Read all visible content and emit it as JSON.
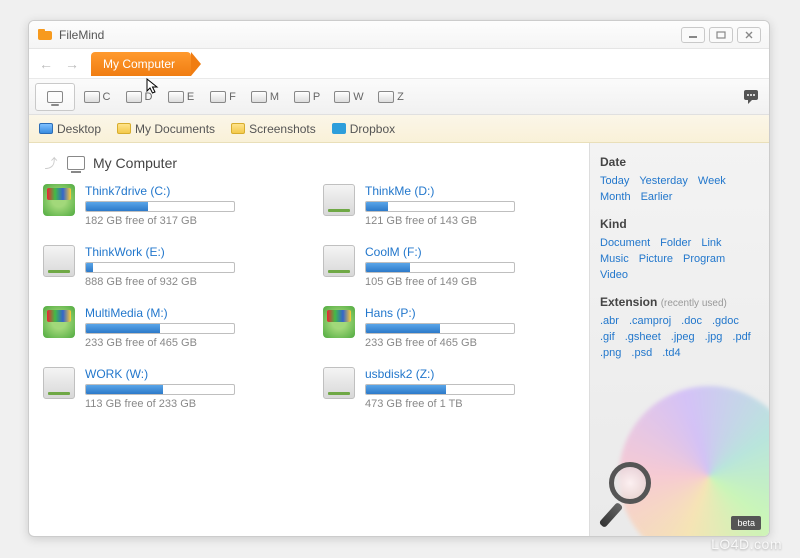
{
  "app": {
    "title": "FileMind",
    "beta": "beta"
  },
  "tab": {
    "label": "My Computer"
  },
  "drive_tabs": [
    "C",
    "D",
    "E",
    "F",
    "M",
    "P",
    "W",
    "Z"
  ],
  "quickbar": [
    {
      "label": "Desktop",
      "icon": "desktop"
    },
    {
      "label": "My Documents",
      "icon": "folder"
    },
    {
      "label": "Screenshots",
      "icon": "folder"
    },
    {
      "label": "Dropbox",
      "icon": "dropbox"
    }
  ],
  "location": {
    "title": "My Computer"
  },
  "drives": [
    {
      "name": "Think7drive (C:)",
      "free": "182 GB free of 317 GB",
      "pct": 42,
      "icon": "win"
    },
    {
      "name": "ThinkMe (D:)",
      "free": "121 GB free of 143 GB",
      "pct": 15,
      "icon": "plain"
    },
    {
      "name": "ThinkWork (E:)",
      "free": "888 GB free of 932 GB",
      "pct": 5,
      "icon": "plain"
    },
    {
      "name": "CoolM (F:)",
      "free": "105 GB free of 149 GB",
      "pct": 30,
      "icon": "plain"
    },
    {
      "name": "MultiMedia (M:)",
      "free": "233 GB free of 465 GB",
      "pct": 50,
      "icon": "win"
    },
    {
      "name": "Hans (P:)",
      "free": "233 GB free of 465 GB",
      "pct": 50,
      "icon": "win"
    },
    {
      "name": "WORK (W:)",
      "free": "113 GB free of 233 GB",
      "pct": 52,
      "icon": "plain"
    },
    {
      "name": "usbdisk2 (Z:)",
      "free": "473 GB free of 1 TB",
      "pct": 54,
      "icon": "plain"
    }
  ],
  "sidebar": {
    "date_h": "Date",
    "dates": [
      "Today",
      "Yesterday",
      "Week",
      "Month",
      "Earlier"
    ],
    "kind_h": "Kind",
    "kinds": [
      "Document",
      "Folder",
      "Link",
      "Music",
      "Picture",
      "Program",
      "Video"
    ],
    "ext_h": "Extension",
    "ext_sub": "(recently used)",
    "exts": [
      ".abr",
      ".camproj",
      ".doc",
      ".gdoc",
      ".gif",
      ".gsheet",
      ".jpeg",
      ".jpg",
      ".pdf",
      ".png",
      ".psd",
      ".td4"
    ]
  },
  "watermark": "LO4D.com"
}
